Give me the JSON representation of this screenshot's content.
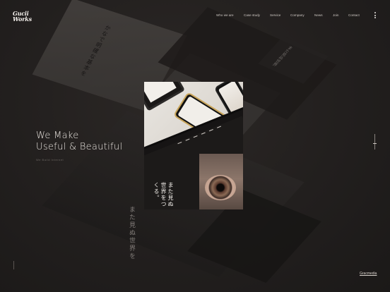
{
  "logo": {
    "line1": "Gucii",
    "line2": "Works"
  },
  "nav": {
    "items": [
      {
        "label": "Who we are"
      },
      {
        "label": "Case study"
      },
      {
        "label": "Service"
      },
      {
        "label": "Company"
      },
      {
        "label": "News"
      },
      {
        "label": "Join"
      },
      {
        "label": "Contact"
      }
    ]
  },
  "hero": {
    "title_line1": "We Make",
    "title_line2": "Useful & Beautiful",
    "subtitle": "We Build Internet"
  },
  "photo": {
    "vertical_text": "また見ぬ世界をつくる。"
  },
  "background": {
    "paper_text": "かなで明確な基本を",
    "small_text": "また見ぬ世界",
    "vertical_text": "また見ぬ世界を"
  },
  "footer": {
    "credit": "Gracmedia"
  },
  "colors": {
    "background": "#1e1b1a",
    "text": "#ece7e2",
    "accent_gold": "#c9a55a"
  }
}
